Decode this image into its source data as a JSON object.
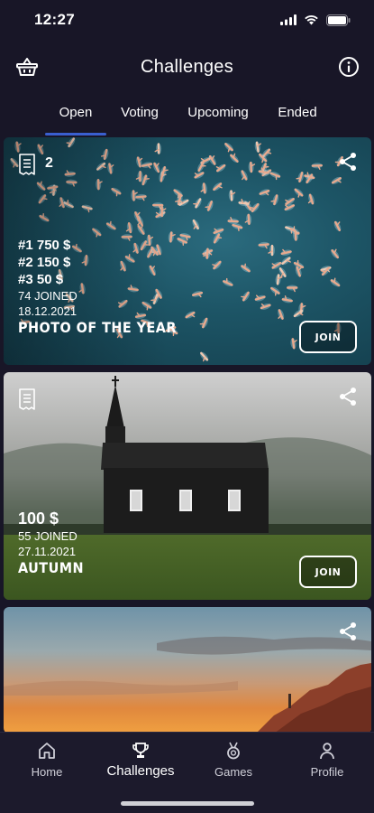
{
  "status": {
    "time": "12:27"
  },
  "header": {
    "title": "Challenges"
  },
  "tabs": [
    {
      "label": "Open",
      "active": true
    },
    {
      "label": "Voting",
      "active": false
    },
    {
      "label": "Upcoming",
      "active": false
    },
    {
      "label": "Ended",
      "active": false
    }
  ],
  "cards": [
    {
      "count": "2",
      "prizes": [
        "#1 750 $",
        "#2 150 $",
        "#3 50 $"
      ],
      "joined": "74 JOINED",
      "date": "18.12.2021",
      "title": "PHOTO OF THE YEAR",
      "join_label": "JOIN"
    },
    {
      "prize": "100 $",
      "joined": "55 JOINED",
      "date": "27.11.2021",
      "title": "AUTUMN",
      "join_label": "JOIN"
    },
    {}
  ],
  "bottom_nav": [
    {
      "label": "Home",
      "icon": "home-icon",
      "active": false
    },
    {
      "label": "Challenges",
      "icon": "trophy-icon",
      "active": true
    },
    {
      "label": "Games",
      "icon": "medal-icon",
      "active": false
    },
    {
      "label": "Profile",
      "icon": "profile-icon",
      "active": false
    }
  ],
  "colors": {
    "background": "#181627",
    "tab_indicator": "#3a5fd0"
  }
}
